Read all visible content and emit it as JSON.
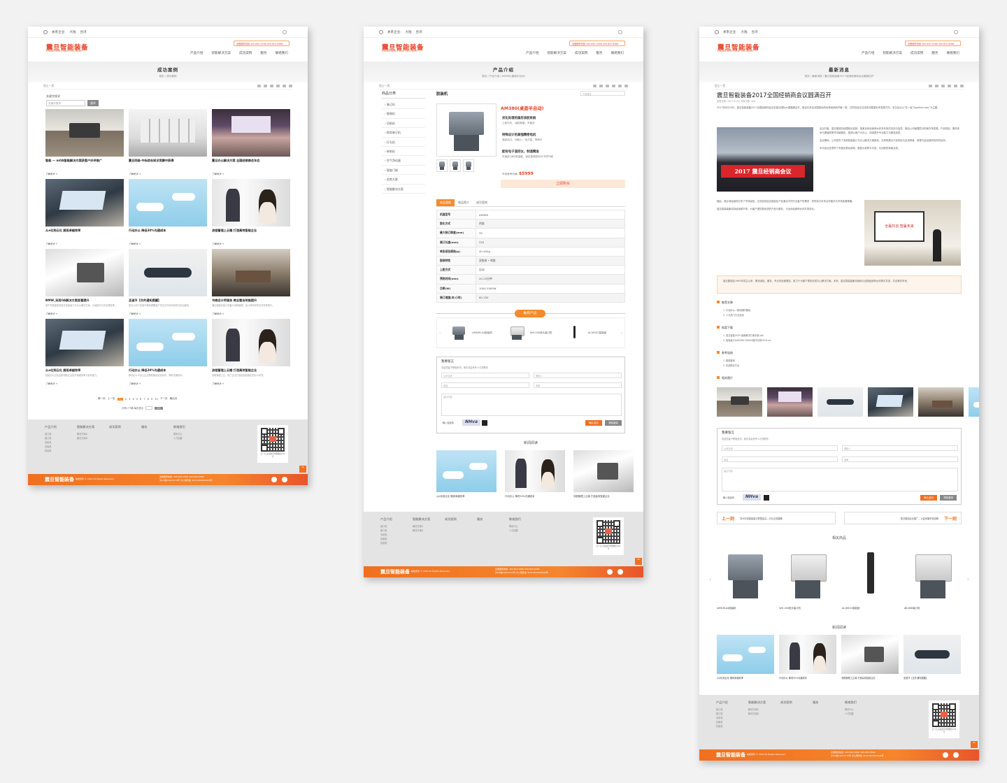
{
  "common": {
    "topbar": {
      "label": "关系企业:",
      "opt1": "大陆",
      "opt2": "台湾"
    },
    "logo": "震旦智能装备",
    "logo_sub": "AURORA INTELLIGENT EQUIPMENT",
    "hotline": "全国服务热线  400-820-0168  400-820-6568",
    "nav": [
      "产品介绍",
      "智能解决方案",
      "成功案例",
      "服务",
      "联络我们"
    ],
    "toolbar_prev": "回上一页",
    "toolbar_fav": "加入收藏",
    "toolbar_size": "字体",
    "footer_cols": [
      {
        "h": "产品介绍",
        "l": [
          "装订机",
          "胶订机",
          "切纸机",
          "压痕机",
          "热熔机"
        ]
      },
      {
        "h": "智能解决方案",
        "l": [
          "解决方案A",
          "解决方案B"
        ]
      },
      {
        "h": "成功案例",
        "l": []
      },
      {
        "h": "服务",
        "l": []
      },
      {
        "h": "联络我们",
        "l": [
          "联系中心",
          "人才招募"
        ]
      }
    ],
    "qr_text": "扫一扫\n关注震旦中国微信公众号",
    "footer_logo": "震旦智能装备",
    "copyright": "版权所有 © 2020 All Rights Reserved.",
    "footer_phone1": "全国服务热线: 400-820-0168  400-820-6568",
    "footer_phone2": "沪ICP备16011570号   沪公网安备 31011502005645号"
  },
  "panel1": {
    "title": "成功案例",
    "crumb": "首页 / 成功案例",
    "kw_label": "关键字搜寻",
    "kw_placeholder": "关键字搜寻",
    "kw_btn": "搜寻",
    "cards": [
      {
        "cap": "智能 — mOA智能解决方案获客户好评推广",
        "desc": "",
        "img": "ph-office"
      },
      {
        "cap": "震旦同级·中标综合知识竞赛中获得",
        "desc": "",
        "img": "ph-printer"
      },
      {
        "cap": "震旦办公解决方案 全国经销商会年会",
        "desc": "",
        "img": "ph-conf"
      },
      {
        "cap": "从e化到云化 展现卓越效率",
        "desc": "",
        "img": "ph-laptop"
      },
      {
        "cap": "行动办公 降低30%沟通成本",
        "desc": "",
        "img": "ph-cloud"
      },
      {
        "cap": "流程管理上云端 打造高效智能企业",
        "desc": "",
        "img": "ph-people"
      },
      {
        "cap": "BMW_采用OA解决方案显著提升",
        "desc": "某汽车集团采用震旦智能装订与办公解决方案，大幅提升文件处理效率。",
        "img": "ph-calc"
      },
      {
        "cap": "圣诞节【交件通知提醒】",
        "desc": "震旦公司于圣诞节期间提醒客户关注交件时间安排与售后服务。",
        "img": "ph-hands"
      },
      {
        "cap": "书商会计师服务 跨业整合效能提升",
        "desc": "通过智能化装订设备与流程管理，会计师事务所文件效率提升。",
        "img": "ph-meeting"
      },
      {
        "cap": "从e化到云化 展现卓越效率",
        "desc": "智能办公云化应用帮助企业提升管理效率与协作能力。",
        "img": "ph-laptop"
      },
      {
        "cap": "行动办公 降低30%沟通成本",
        "desc": "移动办公平台让企业随时随地高效协作，降低沟通成本。",
        "img": "ph-cloud"
      },
      {
        "cap": "流程管理上云端 打造高效智能企业",
        "desc": "流程管理上云，助力企业打造高效智能化的办公环境。",
        "img": "ph-people"
      }
    ],
    "more": "了解更多 +",
    "pager": [
      "第一页",
      "上一页",
      "1",
      "2",
      "3",
      "4",
      "5",
      "6",
      "7",
      "8",
      "9",
      "10",
      "下一页",
      "最后页"
    ],
    "pager_info": "共有177篇  每页显示",
    "pager_go": "GO"
  },
  "panel2": {
    "title": "产品介绍",
    "crumb": "首页 / 产品介绍 / AM380(桌面半自动)",
    "side_title": "商品分类",
    "side_items": [
      "装订机",
      "胶装机",
      "切纸机",
      "财务装订机",
      "打孔机",
      "碎纸机",
      "空气净化器",
      "智能门锁",
      "金库大屏",
      "智能解决方案"
    ],
    "section": "胶装机",
    "search_ph": "产品搜寻",
    "product_name": "AM380(桌面半自动)",
    "features": [
      {
        "a": "优化处理的扇形涂胶系统",
        "b": "上胶均匀、涂胶厚度、不破页"
      },
      {
        "a": "特殊设计的高强精密电机",
        "b": "强劲动力、功耗小、动力强、寿命长"
      },
      {
        "a": "配有电子温控仪，制温精准",
        "b": "可保证1和2胶温度，适应各种胶料与不同气候"
      }
    ],
    "price_label": "市场参考价格:",
    "price": "$5999",
    "buy": "立即购买",
    "tabs": [
      "商品规格",
      "商品简介",
      "成功案例"
    ],
    "specs": [
      [
        "机器型号",
        "AM380"
      ],
      [
        "胶化方式",
        "热熔"
      ],
      [
        "最大装订厚度(mm)",
        "35"
      ],
      [
        "装订长度(mm)",
        "320"
      ],
      [
        "单张纸张规格(g)",
        "40-400g"
      ],
      [
        "胶装特性",
        "双胶装 • 侧胶"
      ],
      [
        "上胶方式",
        "自动"
      ],
      [
        "预热时间(min)",
        "20-25分钟"
      ],
      [
        "功率(W)",
        "1000-2000W"
      ],
      [
        "装订速度(本/小时)",
        "80-150"
      ]
    ],
    "rec_title": "推荐产品",
    "rec": [
      {
        "t": "AM50R-A4胶装机"
      },
      {
        "t": "WH-200双头装订机"
      },
      {
        "t": "AL185G1智能锁"
      }
    ],
    "form_title": "我要留言",
    "form_sub": "欢迎您留下联络资讯，我们将会有专人与您联系",
    "f_company": "公司名称",
    "f_contact": "联络人",
    "f_phone": "电话",
    "f_email": "电邮",
    "f_msg": "建议内容",
    "f_code": "输入验证码",
    "captcha": "NHva",
    "f_submit": "确认送出",
    "f_reset": "清除重填",
    "news_title": "新闻阅读",
    "news": [
      {
        "t": "从e化到云化 展现卓越效率",
        "img": "ph-cloud"
      },
      {
        "t": "行动办公 降低30%沟通成本",
        "img": "ph-people"
      },
      {
        "t": "流程管理上云端 打造高效智能企业",
        "img": "ph-calc"
      }
    ]
  },
  "panel3": {
    "title": "最新消息",
    "crumb": "首页 / 最新消息 / 震旦智能装备2017全国经销商会议圆满召开",
    "atitle": "震旦智能装备2017全国经销商会议圆满召开",
    "meta": "发表日期: 2017-07-04   浏览次数: 404",
    "p1": "2017年6月29日，震旦智能装备2017全国经销商会议在震旦国际大楼圆满召开，数百位来自全国各地的优秀经销商齐聚一堂，共同总结过往成绩并展望未来发展方向。本次会议以“在一起 Togetherness”为主题。",
    "p2": "会议开幕，震旦集团总经理致欢迎辞，感谢全体经销商伙伴多年来的支持与信任。随后公司管理层分别就市场发展、产品规划、服务体系与渠道政策作详细报告，强调以客户为中心，持续提升专业能力与服务品质。",
    "p3": "会议期间，公司发布了多款智能装订与办公解决方案新品，并现场展示产品特色与应用场景，获得与会经销商的热烈反响。",
    "p4": "本次会议还表彰了年度优秀经销商，鼓励大家携手共进，共创新的辉煌业绩。",
    "p5": "随后，各区域经销商分享了市场经验，交流如何结合智能化产品满足不同行业客户的需求，同时探讨未来合作模式与市场拓展策略。",
    "p6": "震旦智能装备将持续深耕市场，为客户提供更优质的产品与服务，与全体经销商伙伴共同成长。",
    "quote": "震旦集团自1965年成立以来，秉持诚信、服务、专业的经营理念，致力于为客户提供优质办公解决方案。未来，震旦智能装备将继续与全国经销商伙伴携手并进，共创美好未来。",
    "group_banner": "2017 震旦经销商会议",
    "meet_screen": "全赢共创 智赢未来",
    "sec1": "推荐文章",
    "sec1_items": [
      "1. 行动办公—助你随时随地",
      "2. 十大热门行业应用"
    ],
    "sec2": "档案下载",
    "sec2_items": [
      "1. 震旦智能2020 最新解决方案手册.pdf",
      "2. 智能装订AURORA FAMILY操作手册2016.xls"
    ],
    "sec3": "参考连结",
    "sec3_items": [
      "1. 集团官网",
      "2. 在线购买平台"
    ],
    "sec4": "相关图片",
    "thumbs": [
      "ph-office",
      "ph-conf",
      "ph-hands",
      "ph-laptop",
      "ph-meeting",
      "ph-cloud"
    ],
    "prev": "上一则",
    "prev_t": "苏州华创智能装订联盟会议—行业交流圆满",
    "next": "下一则",
    "next_t": "震旦集团企业推广，公益传播辛苦品牌",
    "rel_title": "相关商品",
    "related": [
      {
        "t": "AM50R-A4胶装机",
        "img": "machine"
      },
      {
        "t": "WH-200双头装订机",
        "img": "machine machine-w"
      },
      {
        "t": "AL185G1智能锁",
        "img": "lock"
      },
      {
        "t": "AB-808装订机",
        "img": "machine machine-w"
      }
    ],
    "news_title": "新闻阅读",
    "news": [
      {
        "t": "从e化到云化 展现卓越效率",
        "img": "ph-cloud"
      },
      {
        "t": "行动办公 降低30%沟通成本",
        "img": "ph-people"
      },
      {
        "t": "流程管理上云端 打造高效智能企业",
        "img": "ph-calc"
      },
      {
        "t": "圣诞节【交件通知提醒】",
        "img": "ph-hands"
      }
    ]
  }
}
